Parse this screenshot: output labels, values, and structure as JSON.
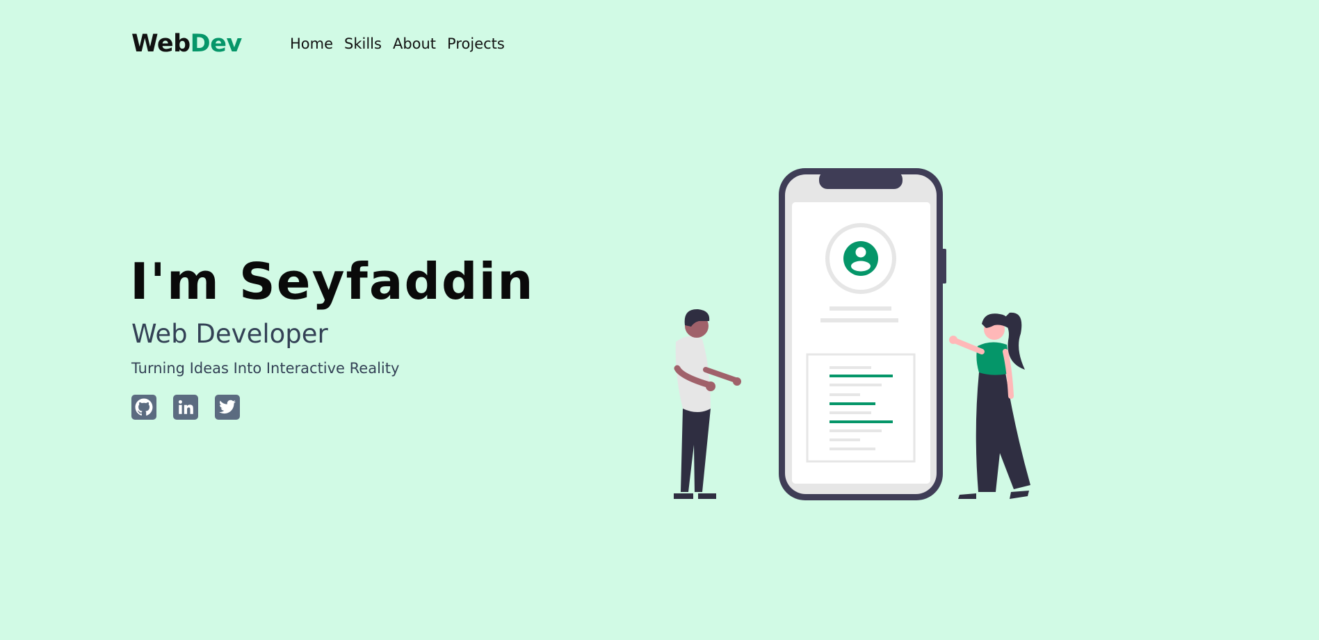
{
  "header": {
    "logo": {
      "part_a": "Web",
      "part_b": "Dev"
    },
    "nav": [
      "Home",
      "Skills",
      "About",
      "Projects"
    ]
  },
  "hero": {
    "title": "I'm Seyfaddin",
    "role": "Web Developer",
    "tagline": "Turning Ideas Into Interactive Reality"
  },
  "socials": [
    {
      "icon": "github-icon"
    },
    {
      "icon": "linkedin-icon"
    },
    {
      "icon": "twitter-icon"
    }
  ],
  "colors": {
    "background": "#d1fae5",
    "accent": "#059669",
    "text_dark": "#111111",
    "text_muted": "#334155",
    "icon_bg": "#5b6b80",
    "phone_frame": "#3f3d56",
    "figure_dark": "#2f2e41",
    "skin_dark": "#a0616a",
    "skin_light": "#ffb8b8"
  }
}
